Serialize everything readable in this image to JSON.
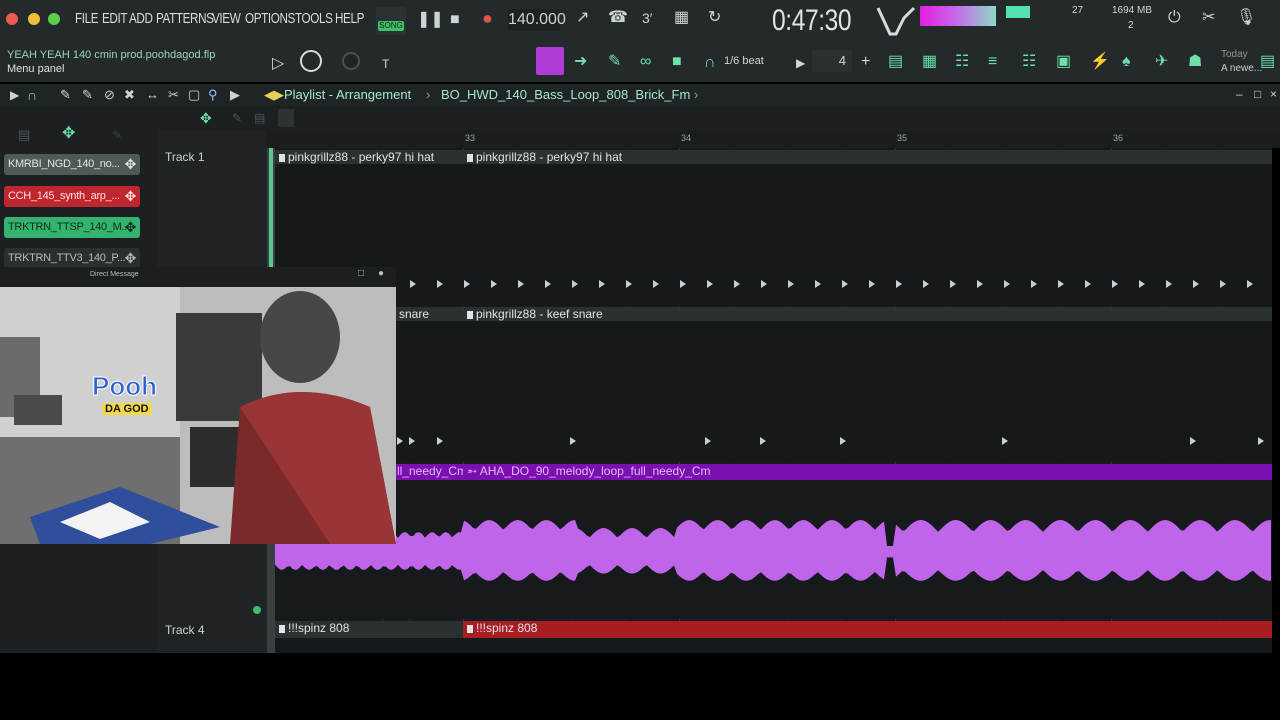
{
  "menu": {
    "items": [
      "FILE",
      "EDIT",
      "ADD",
      "PATTERNS",
      "VIEW",
      "OPTIONS",
      "TOOLS",
      "HELP"
    ]
  },
  "transport": {
    "mode_badge": "SONG",
    "bpm": "140.000",
    "time": "0:47:30",
    "beat_snap": "1/6 beat",
    "pattern_number": "4"
  },
  "cpu_info": {
    "memory": "1694 MB",
    "polyphony": "27",
    "cores": "2"
  },
  "hint": {
    "line1": "Today",
    "line2": "A newe..."
  },
  "project": {
    "filename": "YEAH YEAH 140 cmin prod.poohdagod.flp",
    "menu_panel": "Menu panel"
  },
  "playlist": {
    "title": "Playlist - Arrangement",
    "pattern_name": "BO_HWD_140_Bass_Loop_808_Brick_Fm",
    "bar_numbers": [
      "33",
      "34",
      "35",
      "36"
    ]
  },
  "channels": [
    {
      "label": "KMRBI_NGD_140_no...",
      "color": "#50595a"
    },
    {
      "label": "CCH_145_synth_arp_...",
      "color": "#c0262d"
    },
    {
      "label": "TRKTRN_TTSP_140_M...",
      "color": "#34b36e"
    },
    {
      "label": "TRKTRN_TTV3_140_P...",
      "color": "#2a2f31"
    }
  ],
  "tracks": {
    "track1": "Track 1",
    "track4": "Track 4"
  },
  "clips": {
    "hihat_a": "pinkgrillz88 - perky97 hi hat",
    "hihat_b": "pinkgrillz88 - perky97 hi hat",
    "snare_a": "snare",
    "snare_b": "pinkgrillz88 - keef snare",
    "melody_a": "ll_needy_Cm",
    "melody_b": "AHA_DO_90_melody_loop_full_needy_Cm",
    "bass_a": "!!!spinz 808",
    "bass_b": "!!!spinz 808"
  },
  "webcam": {
    "window_title": "Direct Message",
    "logo_line1": "Pooh",
    "logo_line2": "DA GOD"
  },
  "colors": {
    "accent_green": "#6be0a7",
    "melody_purple": "#7a10b0",
    "waveform": "#c065ea",
    "bass_red": "#a81d24"
  }
}
